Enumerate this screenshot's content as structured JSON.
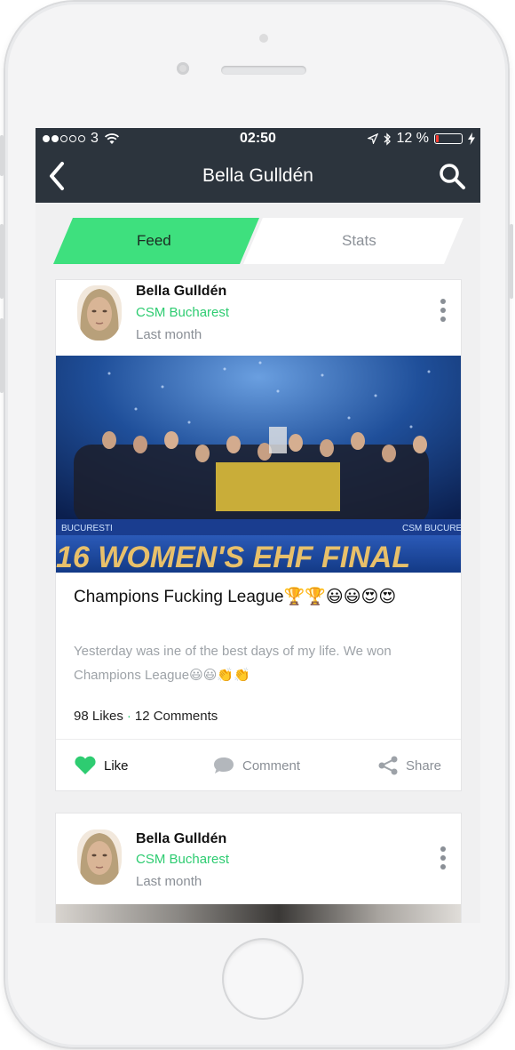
{
  "status_bar": {
    "carrier": "3",
    "time": "02:50",
    "battery_percent": "12 %",
    "battery_level": 0.12
  },
  "nav": {
    "title": "Bella Gulldén",
    "back_icon": "chevron-left-icon",
    "search_icon": "search-icon"
  },
  "tabs": {
    "feed": "Feed",
    "stats": "Stats",
    "active": "Feed",
    "active_color": "#3ee07e"
  },
  "posts": [
    {
      "author": "Bella Gulldén",
      "club": "CSM Bucharest",
      "time": "Last month",
      "image_banner": "16 WOMEN'S EHF FINAL",
      "image_board_left": "BUCURESTI",
      "image_board_right": "CSM BUCURES",
      "title": "Champions Fucking League🏆🏆😃😃😍😍",
      "body": "Yesterday was ine of the best days of my life. We won Champions League😃😃👏👏",
      "likes": "98 Likes",
      "comments": "12 Comments",
      "actions": {
        "like": "Like",
        "comment": "Comment",
        "share": "Share"
      }
    },
    {
      "author": "Bella Gulldén",
      "club": "CSM Bucharest",
      "time": "Last month"
    }
  ],
  "colors": {
    "nav_bg": "#2c343d",
    "accent_green": "#2ecc71",
    "muted_text": "#9ea3a8"
  }
}
